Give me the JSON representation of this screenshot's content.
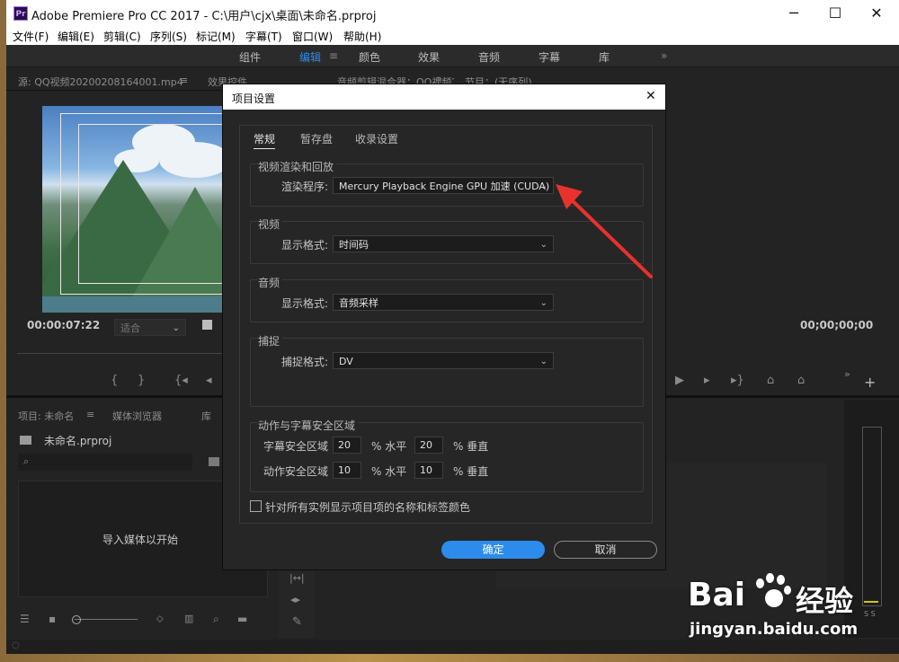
{
  "window": {
    "logo": "Pr",
    "title": "Adobe Premiere Pro CC 2017 - C:\\用户\\cjx\\桌面\\未命名.prproj",
    "minimize": "─",
    "maximize": "☐",
    "close": "✕"
  },
  "menu": [
    "文件(F)",
    "编辑(E)",
    "剪辑(C)",
    "序列(S)",
    "标记(M)",
    "字幕(T)",
    "窗口(W)",
    "帮助(H)"
  ],
  "workspaces": {
    "items": [
      "组件",
      "编辑",
      "颜色",
      "效果",
      "音频",
      "字幕",
      "库"
    ],
    "active": "编辑",
    "menu_icon": "≡",
    "overflow": "»"
  },
  "source_panel": {
    "tab_source": "源: QQ视频20200208164001.mp4",
    "tab_menu": "≡",
    "tab_effects": "效果控件",
    "tab_mixer": "音频剪辑混合器：QQ视频20",
    "overflow": "»",
    "timecode": "00:00:07:22",
    "fit": "适合"
  },
  "program_panel": {
    "tab": "节目：(无序列)",
    "timecode": "00;00;00;00"
  },
  "project_panel": {
    "tab_project": "项目: 未命名",
    "tab_menu": "≡",
    "tab_browser": "媒体浏览器",
    "tab_library": "库",
    "file_name": "未命名.prproj",
    "import_hint": "导入媒体以开始"
  },
  "dialog": {
    "title": "项目设置",
    "close": "✕",
    "tabs": [
      "常规",
      "暂存盘",
      "收录设置"
    ],
    "active_tab": "常规",
    "render": {
      "group_label": "视频渲染和回放",
      "field_label": "渲染程序:",
      "value": "Mercury Playback Engine GPU 加速 (CUDA)"
    },
    "video": {
      "group_label": "视频",
      "field_label": "显示格式:",
      "value": "时间码"
    },
    "audio": {
      "group_label": "音频",
      "field_label": "显示格式:",
      "value": "音频采样"
    },
    "capture": {
      "group_label": "捕捉",
      "field_label": "捕捉格式:",
      "value": "DV"
    },
    "safe_margins": {
      "group_label": "动作与字幕安全区域",
      "title_label": "字幕安全区域",
      "title_h": "20",
      "title_v": "20",
      "action_label": "动作安全区域",
      "action_h": "10",
      "action_v": "10",
      "h_unit": "% 水平",
      "v_unit": "% 垂直"
    },
    "checkbox_label": "针对所有实例显示项目项的名称和标签颜色",
    "ok": "确定",
    "cancel": "取消"
  },
  "watermark": {
    "brand": "Bai",
    "brand_cn": "经验",
    "url": "jingyan.baidu.com"
  },
  "colors": {
    "accent": "#2d8ceb",
    "arrow": "#e8322d"
  }
}
